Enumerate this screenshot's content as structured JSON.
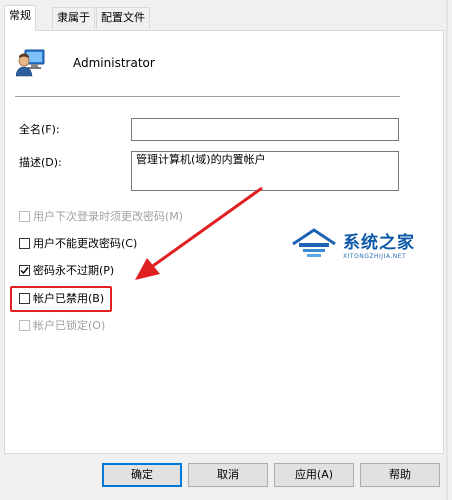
{
  "tabs": [
    {
      "label": "常规"
    },
    {
      "label": "隶属于"
    },
    {
      "label": "配置文件"
    }
  ],
  "user": {
    "name": "Administrator",
    "icon": "user-icon"
  },
  "fields": {
    "fullname_label": "全名(F):",
    "fullname_value": "",
    "description_label": "描述(D):",
    "description_value": "管理计算机(域)的内置帐户"
  },
  "checkboxes": [
    {
      "label": "用户下次登录时须更改密码(M)",
      "checked": false,
      "disabled": true
    },
    {
      "label": "用户不能更改密码(C)",
      "checked": false,
      "disabled": false
    },
    {
      "label": "密码永不过期(P)",
      "checked": true,
      "disabled": false
    },
    {
      "label": "帐户已禁用(B)",
      "checked": false,
      "disabled": false
    },
    {
      "label": "帐户已锁定(O)",
      "checked": false,
      "disabled": true
    }
  ],
  "buttons": {
    "ok": "确定",
    "cancel": "取消",
    "apply": "应用(A)",
    "help": "帮助"
  },
  "watermark": {
    "title": "系统之家",
    "subtitle": "XITONGZHIJIA.NET"
  },
  "colors": {
    "annotation": "#e02020",
    "accent": "#0078d7"
  }
}
